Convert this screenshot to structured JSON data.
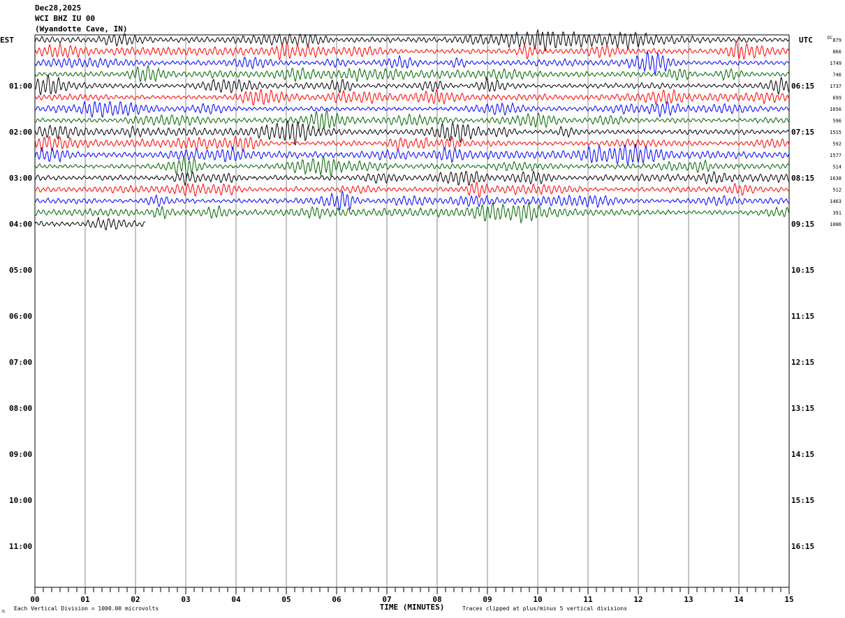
{
  "header": {
    "date": "Dec28,2025",
    "station": "WCI BHZ IU 00",
    "location": "(Wyandotte Cave, IN)"
  },
  "chart_data": {
    "type": "line",
    "subtype": "helicorder",
    "left_timezone": "EST",
    "right_timezone": "UTC",
    "dc_header": "DC",
    "left_labels": [
      "01:00",
      "02:00",
      "03:00",
      "04:00",
      "05:00",
      "06:00",
      "07:00",
      "08:00",
      "09:00",
      "10:00",
      "11:00"
    ],
    "right_labels": [
      "06:15",
      "07:15",
      "08:15",
      "09:15",
      "10:15",
      "11:15",
      "12:15",
      "13:15",
      "14:15",
      "15:15",
      "16:15"
    ],
    "traces_per_hour": 4,
    "minutes_per_trace": 15,
    "trace_colors": [
      "#000000",
      "#ff0000",
      "#0000ff",
      "#006400"
    ],
    "dc_offsets": [
      "879",
      "866",
      "1749",
      "746",
      "1737",
      "699",
      "1656",
      "596",
      "1515",
      "592",
      "1577",
      "514",
      "1638",
      "512",
      "1463",
      "391",
      "1086"
    ],
    "last_trace_minutes": 2.2,
    "x_ticks": [
      "00",
      "01",
      "02",
      "03",
      "04",
      "05",
      "06",
      "07",
      "08",
      "09",
      "10",
      "11",
      "12",
      "13",
      "14",
      "15"
    ],
    "x_range": [
      0,
      15
    ],
    "xlabel": "TIME (MINUTES)",
    "scale_note": "Each Vertical Division = 1000.00 microvolts",
    "clip_note": "Traces clipped at plus/minus 5 vertical divisions",
    "corner_mark": "JL",
    "grid": true
  }
}
